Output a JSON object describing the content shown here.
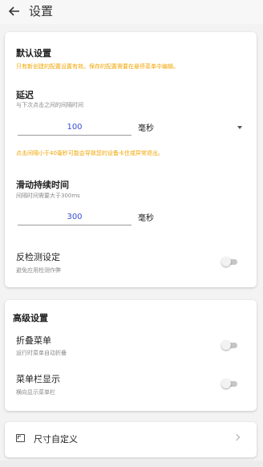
{
  "header": {
    "back_icon": "arrow-left-icon",
    "title": "设置"
  },
  "default_settings": {
    "title": "默认设置",
    "note": "只有新创建的配置设置有效。保存的配置需要在悬停菜单中编辑。",
    "delay": {
      "label": "延迟",
      "description": "与下次点击之间的间隔时间",
      "value": "100",
      "unit": "毫秒",
      "warning": "点击间隔小于40毫秒可能会导致您的设备卡住或异常退出。"
    },
    "swipe_duration": {
      "label": "滑动持续时间",
      "description": "间隔时间需要大于300ms",
      "value": "300",
      "unit": "毫秒"
    },
    "anti_detection": {
      "label": "反检测设定",
      "description": "避免应用检测作弊",
      "enabled": false
    }
  },
  "advanced_settings": {
    "title": "高级设置",
    "collapse_menu": {
      "label": "折叠菜单",
      "description": "运行时菜单自动折叠",
      "enabled": false
    },
    "menu_bar_display": {
      "label": "菜单栏显示",
      "description": "横向显示菜单栏",
      "enabled": false
    }
  },
  "custom_size": {
    "icon": "aspect-ratio-icon",
    "label": "尺寸自定义",
    "chevron_icon": "chevron-right-icon"
  }
}
